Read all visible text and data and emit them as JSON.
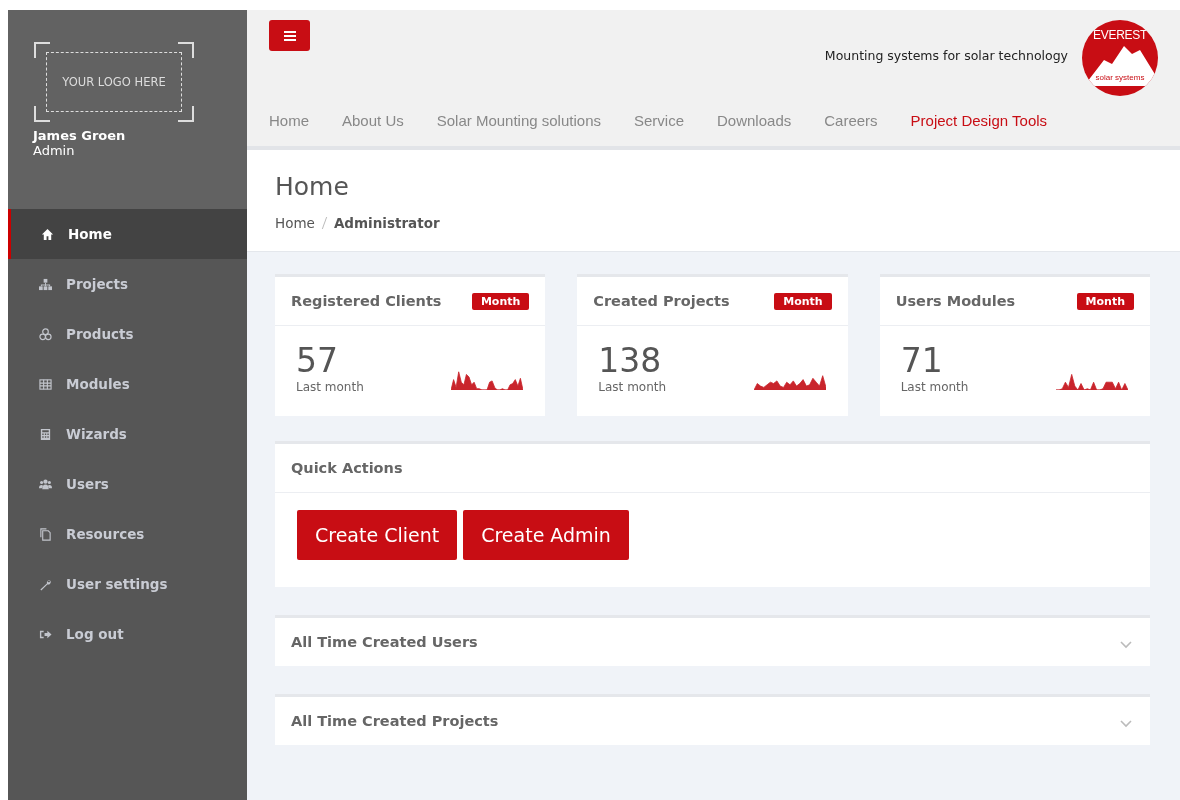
{
  "sidebar": {
    "logo_placeholder": "YOUR LOGO HERE",
    "user_name": "James Groen",
    "user_role": "Admin",
    "items": [
      {
        "label": "Home",
        "selected": true
      },
      {
        "label": "Projects",
        "selected": false
      },
      {
        "label": "Products",
        "selected": false
      },
      {
        "label": "Modules",
        "selected": false
      },
      {
        "label": "Wizards",
        "selected": false
      },
      {
        "label": "Users",
        "selected": false
      },
      {
        "label": "Resources",
        "selected": false
      },
      {
        "label": "User settings",
        "selected": false
      },
      {
        "label": "Log out",
        "selected": false
      }
    ]
  },
  "header": {
    "tagline": "Mounting systems for solar technology",
    "brand": {
      "name": "EVEREST",
      "sub": "solar systems"
    },
    "nav": [
      {
        "label": "Home",
        "selected": false
      },
      {
        "label": "About Us",
        "selected": false
      },
      {
        "label": "Solar Mounting solutions",
        "selected": false
      },
      {
        "label": "Service",
        "selected": false
      },
      {
        "label": "Downloads",
        "selected": false
      },
      {
        "label": "Careers",
        "selected": false
      },
      {
        "label": "Project Design Tools",
        "selected": true
      }
    ]
  },
  "page": {
    "title": "Home",
    "breadcrumb": [
      "Home",
      "Administrator"
    ]
  },
  "stats": [
    {
      "title": "Registered Clients",
      "badge": "Month",
      "value": "57",
      "caption": "Last month"
    },
    {
      "title": "Created Projects",
      "badge": "Month",
      "value": "138",
      "caption": "Last month"
    },
    {
      "title": "Users Modules",
      "badge": "Month",
      "value": "71",
      "caption": "Last month"
    }
  ],
  "quick_actions": {
    "title": "Quick Actions",
    "buttons": [
      "Create Client",
      "Create Admin"
    ]
  },
  "panels": [
    {
      "title": "All Time Created Users",
      "expanded": false
    },
    {
      "title": "All Time Created Projects",
      "expanded": false
    }
  ]
}
